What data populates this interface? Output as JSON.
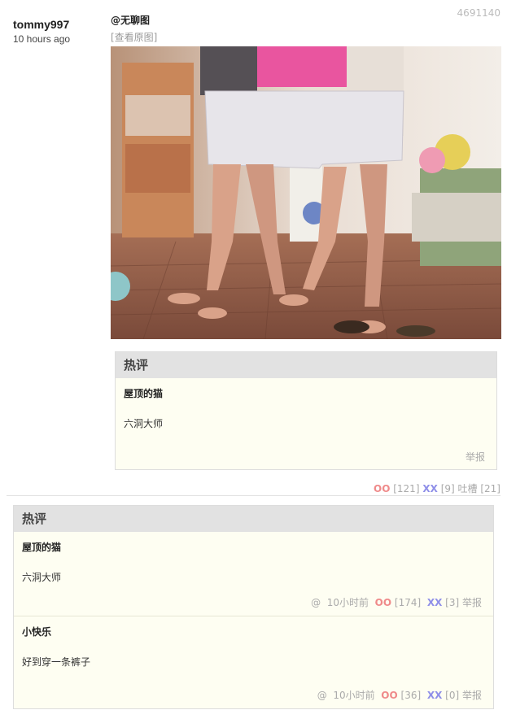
{
  "post": {
    "id": "4691140",
    "author": "tommy997",
    "time": "10 hours ago",
    "title": "@无聊图",
    "view_original": "[查看原图]"
  },
  "inline_hot": {
    "header": "热评",
    "comment": {
      "user": "屋顶的猫",
      "text": "六洞大师",
      "report": "举报"
    }
  },
  "votes": {
    "oo": "OO",
    "oo_count": "[121]",
    "xx": "XX",
    "xx_count": "[9]",
    "tucao": "吐槽",
    "tucao_count": "[21]"
  },
  "hot_section": {
    "header": "热评",
    "comments": [
      {
        "user": "屋顶的猫",
        "text": "六洞大师",
        "at": "@",
        "time": "10小时前",
        "oo": "OO",
        "oo_count": "[174]",
        "xx": "XX",
        "xx_count": "[3]",
        "report": "举报"
      },
      {
        "user": "小快乐",
        "text": "好到穿一条裤子",
        "at": "@",
        "time": "10小时前",
        "oo": "OO",
        "oo_count": "[36]",
        "xx": "XX",
        "xx_count": "[0]",
        "report": "举报"
      }
    ]
  }
}
